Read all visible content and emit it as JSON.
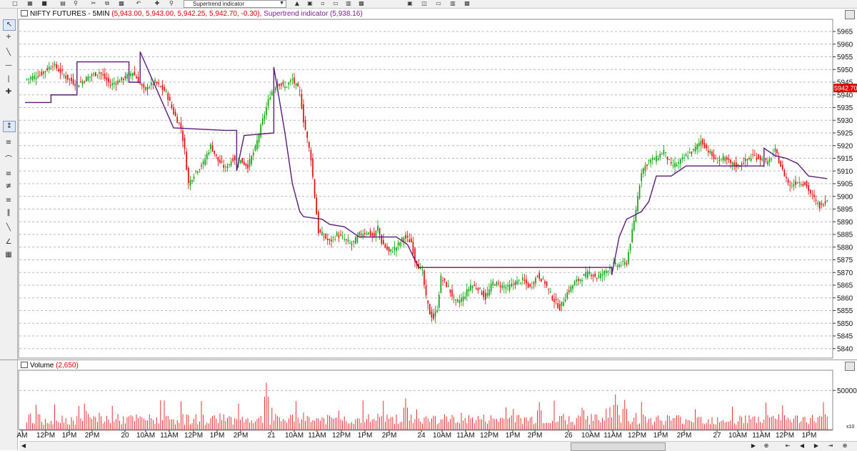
{
  "toolbar": {
    "study_select": "Supertrend indicator",
    "icons": [
      "new-icon",
      "open-icon",
      "save-icon",
      "print-icon",
      "preview-icon",
      "cut-icon",
      "copy-icon",
      "paste-icon",
      "undo-icon",
      "crosshair-icon",
      "zoom-icon",
      "study-icon",
      "window-icon",
      "tile-icon",
      "cascade-icon",
      "layout-icon",
      "chart-type-icon"
    ]
  },
  "left_tools": [
    "pointer-tool",
    "crosshair-tool",
    "line-tool",
    "horizontal-line-tool",
    "vertical-line-tool",
    "zoom-in-tool",
    "fit-tool",
    "channel-tool",
    "arc-tool",
    "fibonacci-tool",
    "fib-time-tool",
    "gann-tool",
    "trend-tool",
    "speed-line-tool",
    "pattern-tool"
  ],
  "price_panel": {
    "title_main": "NIFTY FUTURES - 5MIN",
    "title_ohlc": "(5,943.00, 5,943.00, 5,942.25, 5,942.70, -0.30),",
    "title_ind": "Supertrend indicator",
    "title_ind_val": "(5,938.16)",
    "last_price_label": "5942.700",
    "colors": {
      "up": "#00a000",
      "down": "#e00000",
      "supertrend": "#5a1a78",
      "grid": "#b8b8b8"
    }
  },
  "volume_panel": {
    "title": "Volume",
    "title_val": "(2,650)",
    "axis_label": "50000",
    "multiplier": "x10"
  },
  "chart_data": {
    "type": "candlestick",
    "title": "NIFTY FUTURES - 5MIN",
    "ylim": [
      5837,
      5969
    ],
    "y_ticks": [
      5965,
      5960,
      5955,
      5950,
      5945,
      5940,
      5935,
      5930,
      5925,
      5920,
      5915,
      5910,
      5905,
      5900,
      5895,
      5890,
      5885,
      5880,
      5875,
      5870,
      5865,
      5860,
      5855,
      5850,
      5845,
      5840
    ],
    "x_tick_labels": [
      "AM",
      "12PM",
      "1PM",
      "2PM",
      "20",
      "10AM",
      "11AM",
      "12PM",
      "1PM",
      "2PM",
      "21",
      "10AM",
      "11AM",
      "12PM",
      "1PM",
      "2PM",
      "24",
      "10AM",
      "11AM",
      "12PM",
      "1PM",
      "2PM",
      "26",
      "10AM",
      "11AM",
      "12PM",
      "1PM",
      "2PM",
      "27",
      "10AM",
      "11AM",
      "12PM",
      "1PM"
    ],
    "close_path": [
      [
        0,
        5946
      ],
      [
        8,
        5948
      ],
      [
        15,
        5952
      ],
      [
        22,
        5947
      ],
      [
        28,
        5944
      ],
      [
        34,
        5947
      ],
      [
        40,
        5949
      ],
      [
        46,
        5944
      ],
      [
        52,
        5946
      ],
      [
        58,
        5949
      ],
      [
        64,
        5942
      ],
      [
        70,
        5945
      ],
      [
        76,
        5941
      ],
      [
        80,
        5933
      ],
      [
        84,
        5927
      ],
      [
        86,
        5918
      ],
      [
        88,
        5905
      ],
      [
        92,
        5910
      ],
      [
        96,
        5913
      ],
      [
        100,
        5920
      ],
      [
        104,
        5914
      ],
      [
        108,
        5911
      ],
      [
        112,
        5915
      ],
      [
        116,
        5914
      ],
      [
        120,
        5912
      ],
      [
        124,
        5919
      ],
      [
        128,
        5930
      ],
      [
        132,
        5940
      ],
      [
        136,
        5945
      ],
      [
        140,
        5943
      ],
      [
        144,
        5946
      ],
      [
        148,
        5941
      ],
      [
        150,
        5930
      ],
      [
        154,
        5915
      ],
      [
        156,
        5900
      ],
      [
        158,
        5886
      ],
      [
        160,
        5885
      ],
      [
        164,
        5882
      ],
      [
        168,
        5885
      ],
      [
        172,
        5883
      ],
      [
        176,
        5881
      ],
      [
        180,
        5885
      ],
      [
        184,
        5886
      ],
      [
        188,
        5884
      ],
      [
        190,
        5888
      ],
      [
        192,
        5882
      ],
      [
        196,
        5878
      ],
      [
        200,
        5880
      ],
      [
        204,
        5884
      ],
      [
        208,
        5882
      ],
      [
        210,
        5875
      ],
      [
        214,
        5870
      ],
      [
        216,
        5860
      ],
      [
        218,
        5854
      ],
      [
        220,
        5852
      ],
      [
        222,
        5856
      ],
      [
        224,
        5868
      ],
      [
        228,
        5864
      ],
      [
        232,
        5858
      ],
      [
        236,
        5860
      ],
      [
        240,
        5865
      ],
      [
        244,
        5864
      ],
      [
        248,
        5860
      ],
      [
        252,
        5866
      ],
      [
        256,
        5865
      ],
      [
        260,
        5864
      ],
      [
        264,
        5866
      ],
      [
        268,
        5867
      ],
      [
        272,
        5864
      ],
      [
        276,
        5869
      ],
      [
        280,
        5866
      ],
      [
        284,
        5860
      ],
      [
        288,
        5856
      ],
      [
        292,
        5862
      ],
      [
        296,
        5866
      ],
      [
        300,
        5868
      ],
      [
        304,
        5870
      ],
      [
        308,
        5868
      ],
      [
        312,
        5870
      ],
      [
        316,
        5873
      ],
      [
        320,
        5873
      ],
      [
        324,
        5874
      ],
      [
        328,
        5890
      ],
      [
        332,
        5910
      ],
      [
        336,
        5914
      ],
      [
        340,
        5915
      ],
      [
        344,
        5918
      ],
      [
        348,
        5912
      ],
      [
        352,
        5913
      ],
      [
        356,
        5916
      ],
      [
        360,
        5918
      ],
      [
        364,
        5922
      ],
      [
        368,
        5918
      ],
      [
        372,
        5914
      ],
      [
        376,
        5915
      ],
      [
        380,
        5913
      ],
      [
        384,
        5912
      ],
      [
        388,
        5914
      ],
      [
        392,
        5916
      ],
      [
        396,
        5915
      ],
      [
        400,
        5913
      ],
      [
        404,
        5918
      ],
      [
        408,
        5910
      ],
      [
        412,
        5904
      ],
      [
        416,
        5906
      ],
      [
        420,
        5905
      ],
      [
        424,
        5900
      ],
      [
        428,
        5896
      ],
      [
        432,
        5899
      ]
    ],
    "supertrend_path": [
      [
        0,
        5937
      ],
      [
        14,
        5937
      ],
      [
        14,
        5940
      ],
      [
        28,
        5940
      ],
      [
        28,
        5953
      ],
      [
        56,
        5953
      ],
      [
        56,
        5945
      ],
      [
        62,
        5945
      ],
      [
        62,
        5957
      ],
      [
        80,
        5927
      ],
      [
        108,
        5926
      ],
      [
        114,
        5926
      ],
      [
        114,
        5910
      ],
      [
        118,
        5924
      ],
      [
        134,
        5925
      ],
      [
        134,
        5951
      ],
      [
        140,
        5925
      ],
      [
        144,
        5905
      ],
      [
        148,
        5894
      ],
      [
        150,
        5892
      ],
      [
        160,
        5891
      ],
      [
        164,
        5889
      ],
      [
        172,
        5888
      ],
      [
        176,
        5886
      ],
      [
        180,
        5884
      ],
      [
        190,
        5884
      ],
      [
        200,
        5884
      ],
      [
        206,
        5881
      ],
      [
        212,
        5872
      ],
      [
        240,
        5872
      ],
      [
        270,
        5872
      ],
      [
        310,
        5872
      ],
      [
        316,
        5872
      ],
      [
        316,
        5869
      ],
      [
        320,
        5884
      ],
      [
        324,
        5891
      ],
      [
        332,
        5894
      ],
      [
        336,
        5898
      ],
      [
        340,
        5908
      ],
      [
        348,
        5908
      ],
      [
        352,
        5910
      ],
      [
        356,
        5912
      ],
      [
        384,
        5912
      ],
      [
        398,
        5912
      ],
      [
        398,
        5919
      ],
      [
        404,
        5916
      ],
      [
        410,
        5915
      ],
      [
        416,
        5913
      ],
      [
        422,
        5908
      ],
      [
        432,
        5907
      ]
    ],
    "volume_peaks": [
      [
        130,
        60000
      ],
      [
        205,
        40000
      ],
      [
        277,
        35000
      ],
      [
        318,
        45000
      ],
      [
        323,
        38000
      ]
    ]
  }
}
